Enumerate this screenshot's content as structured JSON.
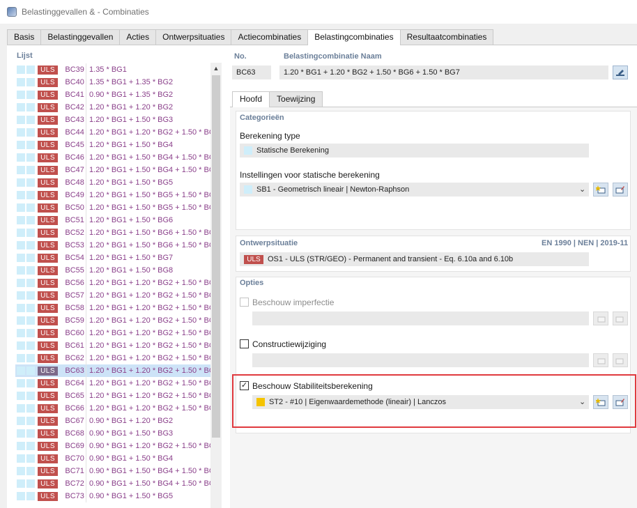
{
  "window": {
    "title": "Belastinggevallen & - Combinaties"
  },
  "tabs": [
    "Basis",
    "Belastinggevallen",
    "Acties",
    "Ontwerpsituaties",
    "Actiecombinaties",
    "Belastingcombinaties",
    "Resultaatcombinaties"
  ],
  "list": {
    "title": "Lijst",
    "badge": "ULS",
    "rows": [
      {
        "id": "BC39",
        "formula": "1.35 * BG1"
      },
      {
        "id": "BC40",
        "formula": "1.35 * BG1 + 1.35 * BG2"
      },
      {
        "id": "BC41",
        "formula": "0.90 * BG1 + 1.35 * BG2"
      },
      {
        "id": "BC42",
        "formula": "1.20 * BG1 + 1.20 * BG2"
      },
      {
        "id": "BC43",
        "formula": "1.20 * BG1 + 1.50 * BG3"
      },
      {
        "id": "BC44",
        "formula": "1.20 * BG1 + 1.20 * BG2 + 1.50 * BG"
      },
      {
        "id": "BC45",
        "formula": "1.20 * BG1 + 1.50 * BG4"
      },
      {
        "id": "BC46",
        "formula": "1.20 * BG1 + 1.50 * BG4 + 1.50 * BG"
      },
      {
        "id": "BC47",
        "formula": "1.20 * BG1 + 1.50 * BG4 + 1.50 * BG"
      },
      {
        "id": "BC48",
        "formula": "1.20 * BG1 + 1.50 * BG5"
      },
      {
        "id": "BC49",
        "formula": "1.20 * BG1 + 1.50 * BG5 + 1.50 * BG"
      },
      {
        "id": "BC50",
        "formula": "1.20 * BG1 + 1.50 * BG5 + 1.50 * BG"
      },
      {
        "id": "BC51",
        "formula": "1.20 * BG1 + 1.50 * BG6"
      },
      {
        "id": "BC52",
        "formula": "1.20 * BG1 + 1.50 * BG6 + 1.50 * BG"
      },
      {
        "id": "BC53",
        "formula": "1.20 * BG1 + 1.50 * BG6 + 1.50 * BG"
      },
      {
        "id": "BC54",
        "formula": "1.20 * BG1 + 1.50 * BG7"
      },
      {
        "id": "BC55",
        "formula": "1.20 * BG1 + 1.50 * BG8"
      },
      {
        "id": "BC56",
        "formula": "1.20 * BG1 + 1.20 * BG2 + 1.50 * BG"
      },
      {
        "id": "BC57",
        "formula": "1.20 * BG1 + 1.20 * BG2 + 1.50 * BG"
      },
      {
        "id": "BC58",
        "formula": "1.20 * BG1 + 1.20 * BG2 + 1.50 * BG"
      },
      {
        "id": "BC59",
        "formula": "1.20 * BG1 + 1.20 * BG2 + 1.50 * BG"
      },
      {
        "id": "BC60",
        "formula": "1.20 * BG1 + 1.20 * BG2 + 1.50 * BG"
      },
      {
        "id": "BC61",
        "formula": "1.20 * BG1 + 1.20 * BG2 + 1.50 * BG"
      },
      {
        "id": "BC62",
        "formula": "1.20 * BG1 + 1.20 * BG2 + 1.50 * BG"
      },
      {
        "id": "BC63",
        "formula": "1.20 * BG1 + 1.20 * BG2 + 1.50 * BG",
        "selected": true
      },
      {
        "id": "BC64",
        "formula": "1.20 * BG1 + 1.20 * BG2 + 1.50 * BG"
      },
      {
        "id": "BC65",
        "formula": "1.20 * BG1 + 1.20 * BG2 + 1.50 * BG"
      },
      {
        "id": "BC66",
        "formula": "1.20 * BG1 + 1.20 * BG2 + 1.50 * BG"
      },
      {
        "id": "BC67",
        "formula": "0.90 * BG1 + 1.20 * BG2"
      },
      {
        "id": "BC68",
        "formula": "0.90 * BG1 + 1.50 * BG3"
      },
      {
        "id": "BC69",
        "formula": "0.90 * BG1 + 1.20 * BG2 + 1.50 * BG"
      },
      {
        "id": "BC70",
        "formula": "0.90 * BG1 + 1.50 * BG4"
      },
      {
        "id": "BC71",
        "formula": "0.90 * BG1 + 1.50 * BG4 + 1.50 * BG"
      },
      {
        "id": "BC72",
        "formula": "0.90 * BG1 + 1.50 * BG4 + 1.50 * BG"
      },
      {
        "id": "BC73",
        "formula": "0.90 * BG1 + 1.50 * BG5"
      }
    ]
  },
  "header": {
    "no_label": "No.",
    "no_value": "BC63",
    "name_label": "Belastingcombinatie Naam",
    "name_value": "1.20 * BG1 + 1.20 * BG2 + 1.50 * BG6 + 1.50 * BG7"
  },
  "subtabs": [
    "Hoofd",
    "Toewijzing"
  ],
  "categories": {
    "title": "Categorieën",
    "calc_type_label": "Berekening type",
    "calc_type_value": "Statische Berekening",
    "static_settings_label": "Instellingen voor statische berekening",
    "static_settings_value": "SB1 - Geometrisch lineair | Newton-Raphson"
  },
  "design_situation": {
    "title": "Ontwerpsituatie",
    "standard": "EN 1990 | NEN | 2019-11",
    "badge": "ULS",
    "value": "OS1 - ULS (STR/GEO) - Permanent and transient - Eq. 6.10a and 6.10b"
  },
  "options": {
    "title": "Opties",
    "imperfection_label": "Beschouw imperfectie",
    "structure_mod_label": "Constructiewijziging",
    "stability_label": "Beschouw Stabiliteitsberekening",
    "stability_value": "ST2 - #10 | Eigenwaardemethode (lineair) | Lanczos"
  },
  "colors": {
    "uls_badge": "#c0504d",
    "static_swatch": "#cfeefa",
    "stability_swatch": "#f5c400",
    "highlight": "#e0393e"
  }
}
